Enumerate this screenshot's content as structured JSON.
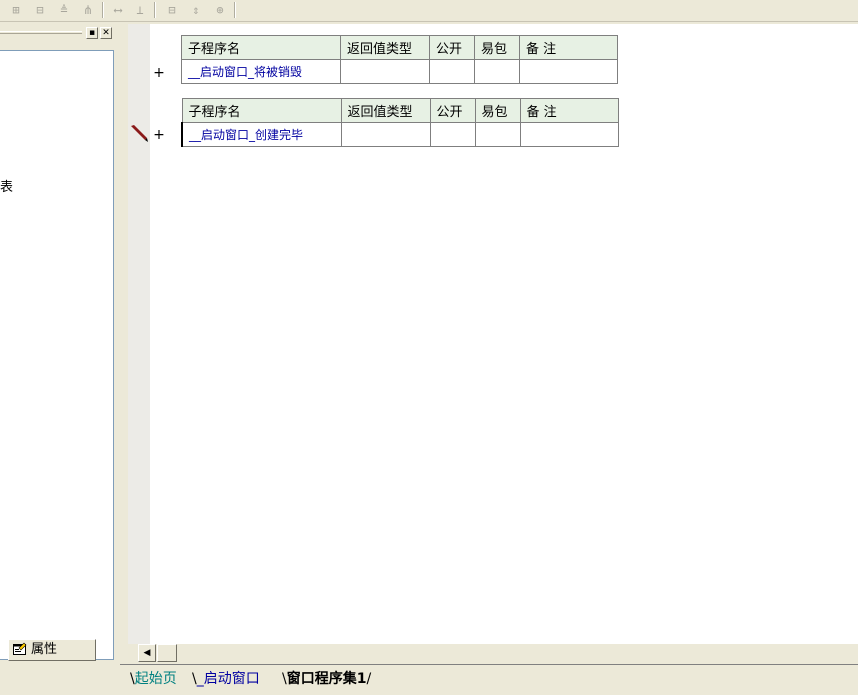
{
  "toolbar": {
    "buttons": [
      {
        "name": "align-left-icon",
        "glyph": "⊞"
      },
      {
        "name": "align-center-icon",
        "glyph": "⊟"
      },
      {
        "name": "align-top-icon",
        "glyph": "≜"
      },
      {
        "name": "align-middle-icon",
        "glyph": "⋔"
      },
      {
        "name": "same-width-icon",
        "glyph": "⟷"
      },
      {
        "name": "same-height-icon",
        "glyph": "⊥"
      },
      {
        "name": "h-space-icon",
        "glyph": "⊟"
      },
      {
        "name": "v-space-icon",
        "glyph": "⇕"
      },
      {
        "name": "center-form-icon",
        "glyph": "⊕"
      }
    ]
  },
  "left_panel": {
    "body_text": "表",
    "props_tab_label": "属性"
  },
  "editor": {
    "headers": {
      "name": "子程序名",
      "return_type": "返回值类型",
      "public": "公开",
      "easy_pkg": "易包",
      "remark": "备 注"
    },
    "subs": [
      {
        "name": "__启动窗口_将被销毁",
        "return_type": "",
        "public": "",
        "easy_pkg": "",
        "remark": ""
      },
      {
        "name": "__启动窗口_创建完毕",
        "return_type": "",
        "public": "",
        "easy_pkg": "",
        "remark": ""
      }
    ],
    "plus_glyph": "+"
  },
  "tabs": [
    {
      "label": "起始页",
      "active": false,
      "color": "#008080"
    },
    {
      "label": "_启动窗口",
      "active": false,
      "color": "#0000a0"
    },
    {
      "label": "窗口程序集1",
      "active": true,
      "color": "#000000"
    }
  ],
  "colors": {
    "header_bg": "#e7f1e4",
    "link_blue": "#0000a0",
    "pencil": "#8b1a1a"
  }
}
